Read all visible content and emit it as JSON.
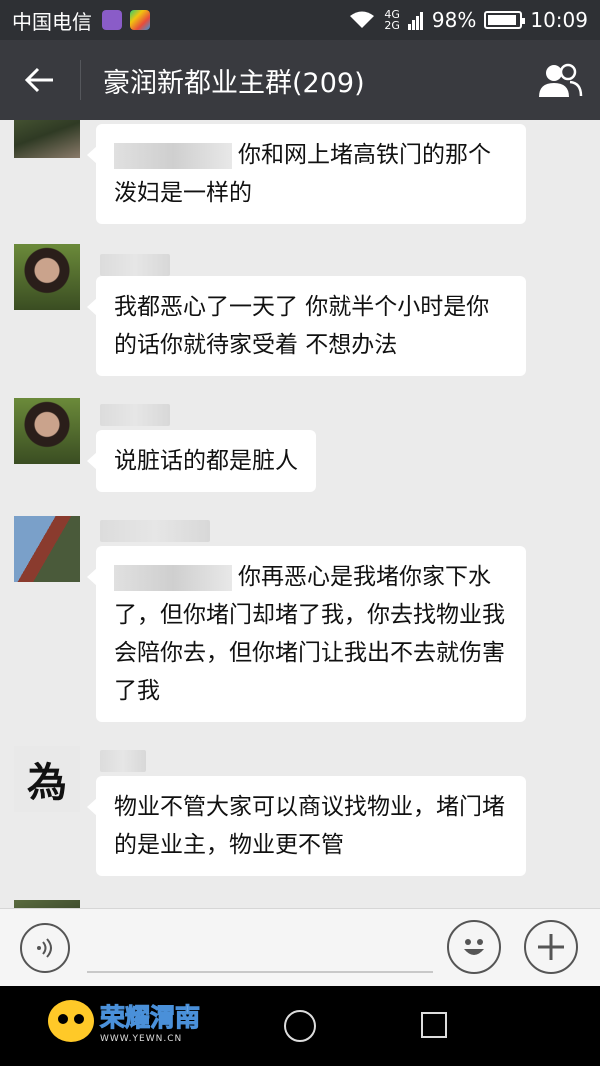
{
  "status_bar": {
    "carrier": "中国电信",
    "network_top": "4G",
    "network_bottom": "2G",
    "battery": "98%",
    "time": "10:09"
  },
  "header": {
    "title": "豪润新都业主群(209)",
    "back_icon": "back-arrow-icon",
    "members_icon": "group-members-icon"
  },
  "messages": [
    {
      "avatar": "photo",
      "text": "你和网上堵高铁门的那个泼妇是一样的"
    },
    {
      "avatar": "photo",
      "text": "我都恶心了一天了 你就半个小时是你的话你就待家受着 不想办法"
    },
    {
      "avatar": "photo",
      "text": "说脏话的都是脏人"
    },
    {
      "avatar": "photo",
      "text": "你再恶心是我堵你家下水了，但你堵门却堵了我，你去找物业我会陪你去，但你堵门让我出不去就伤害了我"
    },
    {
      "avatar": "calligraphy",
      "avatar_char": "為",
      "text": "物业不管大家可以商议找物业，堵门堵的是业主，物业更不管"
    }
  ],
  "input_bar": {
    "voice_icon": "voice-icon",
    "emoji_icon": "emoji-icon",
    "plus_icon": "plus-icon"
  },
  "watermark": {
    "name": "荣耀渭南",
    "url": "WWW.YEWN.CN"
  }
}
